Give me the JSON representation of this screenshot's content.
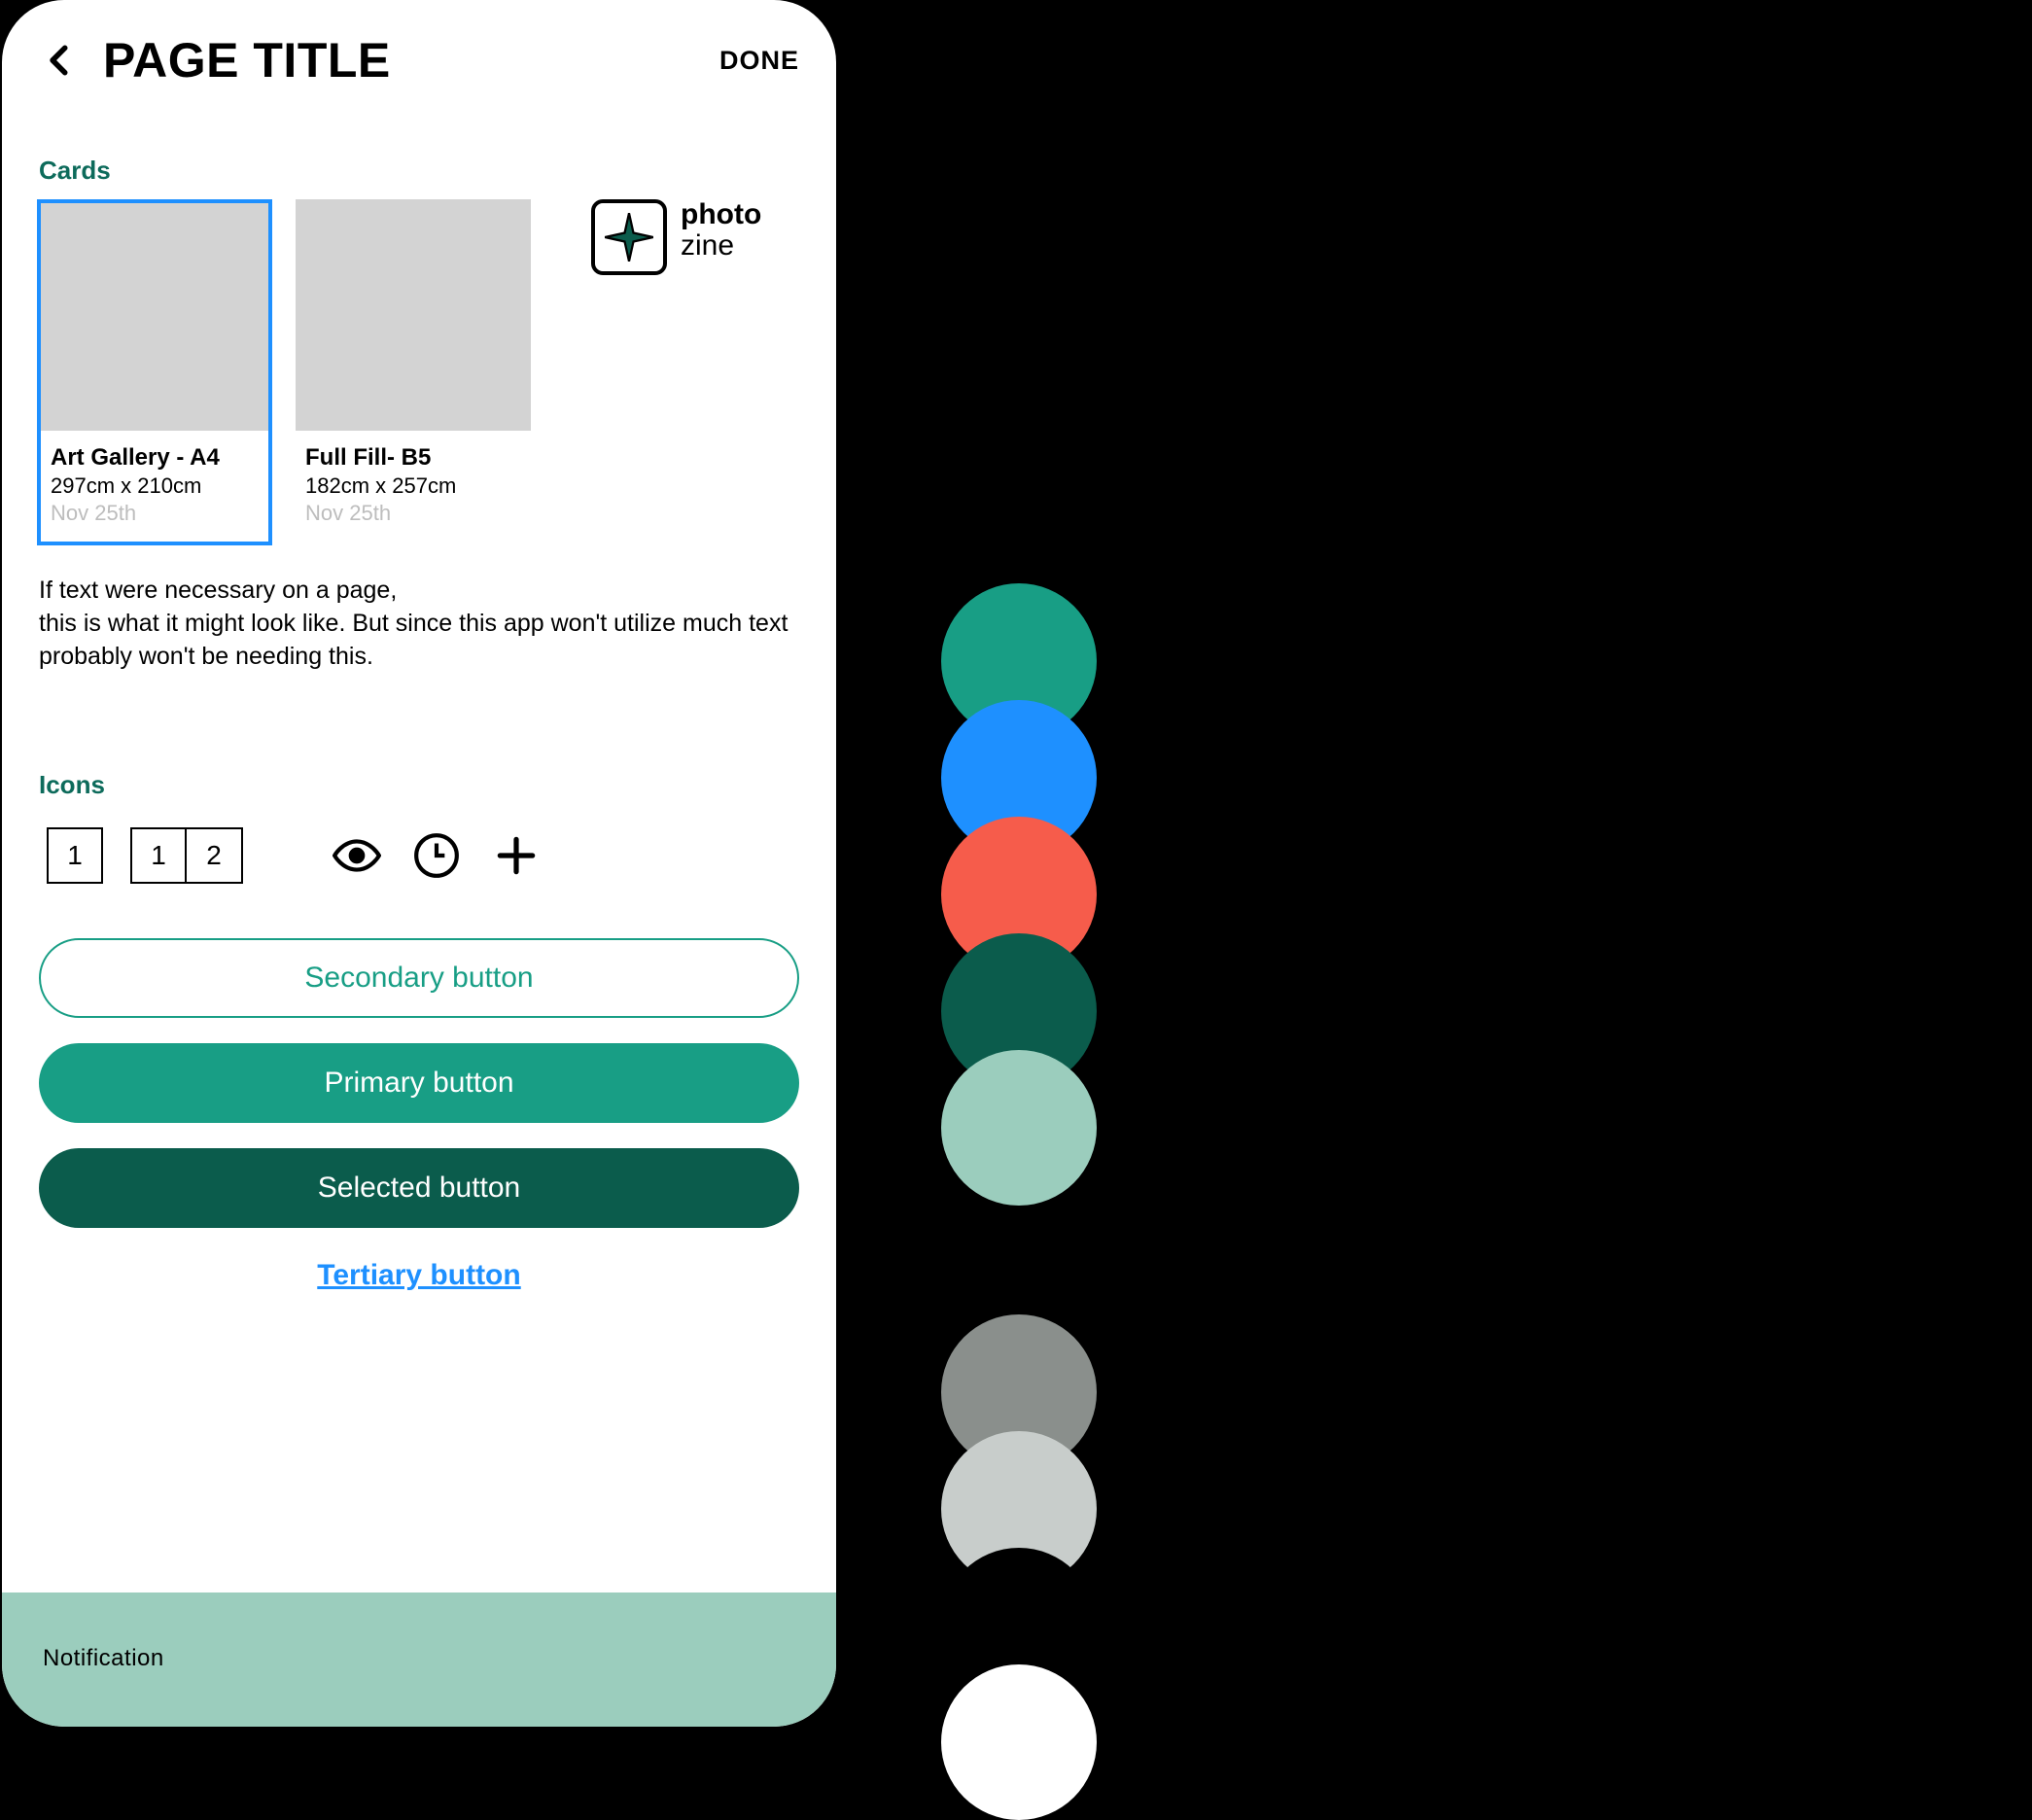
{
  "header": {
    "title": "PAGE TITLE",
    "done": "DONE"
  },
  "cards": {
    "label": "Cards",
    "items": [
      {
        "title": "Art Gallery - A4",
        "dim": "297cm x 210cm",
        "date": "Nov 25th",
        "selected": true
      },
      {
        "title": "Full Fill- B5",
        "dim": "182cm x 257cm",
        "date": "Nov 25th",
        "selected": false
      }
    ]
  },
  "brand": {
    "top": "photo",
    "bottom": "zine"
  },
  "body_text": "If text were necessary on a page,\nthis is what it might look like. But since this app won't utilize much text probably won't be needing this.",
  "icons": {
    "label": "Icons",
    "box_single": "1",
    "box_pair_a": "1",
    "box_pair_b": "2"
  },
  "buttons": {
    "secondary": "Secondary button",
    "primary": "Primary button",
    "selected": "Selected button",
    "tertiary": "Tertiary button"
  },
  "notification": "Notification",
  "palette": {
    "group1": [
      "#189E85",
      "#1E90FF",
      "#F65C4B",
      "#0B5C4C",
      "#9BCDBD"
    ],
    "group2": [
      "#8A8F8C",
      "#C8CDCB",
      "#000000",
      "#FFFFFF"
    ]
  }
}
